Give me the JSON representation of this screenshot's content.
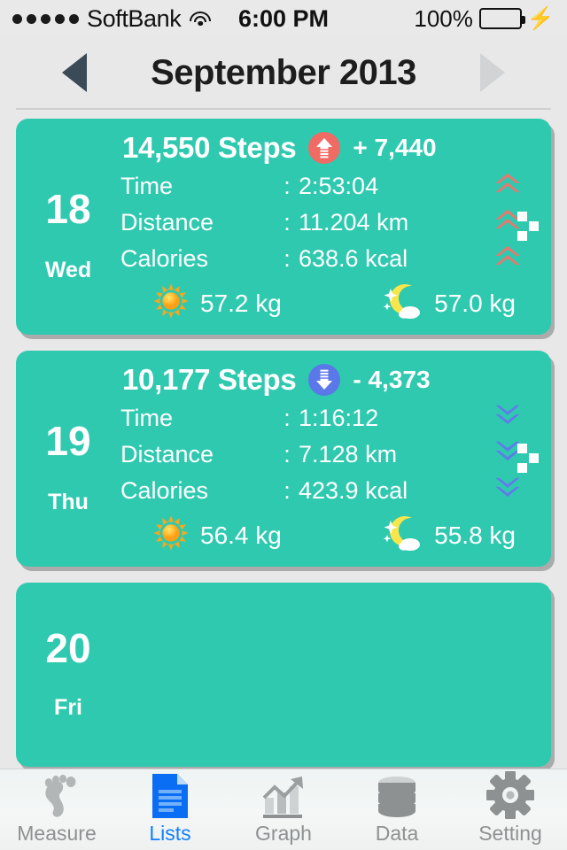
{
  "statusbar": {
    "signal_dots": 5,
    "carrier": "SoftBank",
    "wifi_icon": "wifi-icon",
    "time": "6:00 PM",
    "battery_percent": "100%",
    "battery_level": 100,
    "charging_icon": "lightning-bolt-icon",
    "battery_color": "#3ddc52"
  },
  "header": {
    "title": "September 2013",
    "prev_icon": "triangle-left-icon",
    "next_icon": "triangle-right-icon",
    "prev_enabled": true,
    "next_enabled": false
  },
  "theme": {
    "card_color": "#2fc9b0",
    "background": "#e8e8e8",
    "up_badge_color": "#ef6b63",
    "down_badge_color": "#5a78e8",
    "active_tab_color": "#1080ff",
    "inactive_tab_color": "#8e9191"
  },
  "labels": {
    "time": "Time",
    "distance": "Distance",
    "calories": "Calories",
    "colon": ":"
  },
  "days": [
    {
      "day_number": "18",
      "day_name": "Wed",
      "steps": "14,550 Steps",
      "delta": "+ 7,440",
      "delta_direction": "up",
      "badge_icon": "arrow-up-badge-icon",
      "time": "2:53:04",
      "distance": "11.204 km",
      "calories": "638.6 kcal",
      "trend_icon": "double-chevron-up-icon",
      "trend_direction": "up",
      "morning_weight": "57.2 kg",
      "night_weight": "57.0 kg",
      "morning_icon": "sun-icon",
      "night_icon": "moon-cloud-icon",
      "drag_icon": "drag-handle-icon",
      "empty": false
    },
    {
      "day_number": "19",
      "day_name": "Thu",
      "steps": "10,177 Steps",
      "delta": "- 4,373",
      "delta_direction": "down",
      "badge_icon": "arrow-down-badge-icon",
      "time": "1:16:12",
      "distance": "7.128 km",
      "calories": "423.9 kcal",
      "trend_icon": "double-chevron-down-icon",
      "trend_direction": "down",
      "morning_weight": "56.4 kg",
      "night_weight": "55.8 kg",
      "morning_icon": "sun-icon",
      "night_icon": "moon-cloud-icon",
      "drag_icon": "drag-handle-icon",
      "empty": false
    },
    {
      "day_number": "20",
      "day_name": "Fri",
      "empty": true
    }
  ],
  "tabs": [
    {
      "label": "Measure",
      "icon": "footprints-icon",
      "active": false
    },
    {
      "label": "Lists",
      "icon": "document-lines-icon",
      "active": true
    },
    {
      "label": "Graph",
      "icon": "bar-chart-arrow-icon",
      "active": false
    },
    {
      "label": "Data",
      "icon": "database-icon",
      "active": false
    },
    {
      "label": "Setting",
      "icon": "gear-icon",
      "active": false
    }
  ]
}
